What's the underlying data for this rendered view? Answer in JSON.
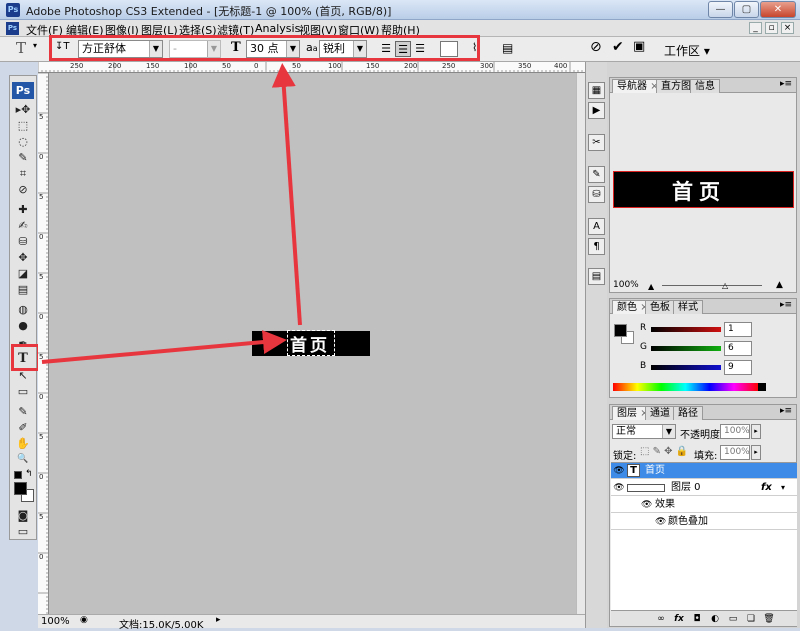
{
  "window": {
    "title": "Adobe Photoshop CS3 Extended - [无标题-1 @ 100% (首页, RGB/8)]",
    "app_icon": "Ps"
  },
  "menubar": {
    "items": [
      "文件(F)",
      "编辑(E)",
      "图像(I)",
      "图层(L)",
      "选择(S)",
      "滤镜(T)",
      "Analysis",
      "视图(V)",
      "窗口(W)",
      "帮助(H)"
    ]
  },
  "options": {
    "font_family": "方正舒体",
    "font_style": "-",
    "font_size": "30 点",
    "aa_glyph": "a",
    "aa_glyph_small": "a",
    "antialias": "锐利",
    "workspace": "工作区",
    "size_glyph": "T",
    "tool_glyph": "T",
    "orient_glyph": "↧T"
  },
  "toolbox": {
    "logo": "Ps",
    "tools": [
      "▸✥",
      "⬚",
      "◌",
      "✎",
      "⌗",
      "⊘",
      "✚",
      "✍",
      "⛁",
      "✥",
      "◪",
      "▤",
      "◍",
      "●",
      "✒",
      "T",
      "↖",
      "▭",
      "✎",
      "✐",
      "✋",
      "🔍"
    ]
  },
  "ruler": {
    "h_labels": [
      "250",
      "200",
      "150",
      "100",
      "50",
      "0",
      "50",
      "100",
      "150",
      "200",
      "250",
      "300",
      "350",
      "400"
    ],
    "v_labels": [
      "5",
      "0",
      "5",
      "0",
      "5",
      "0",
      "5",
      "0",
      "5",
      "0",
      "5",
      "0"
    ]
  },
  "canvas": {
    "text": "首页"
  },
  "status": {
    "zoom": "100%",
    "doc_info": "文档:15.0K/5.00K"
  },
  "navigator": {
    "tabs": [
      "导航器",
      "直方图",
      "信息"
    ],
    "preview_text": "首页",
    "zoom": "100%"
  },
  "color": {
    "tabs": [
      "颜色",
      "色板",
      "样式"
    ],
    "channels": [
      {
        "label": "R",
        "value": "1",
        "color": "#d01010"
      },
      {
        "label": "G",
        "value": "6",
        "color": "#10b010"
      },
      {
        "label": "B",
        "value": "9",
        "color": "#1010d0"
      }
    ]
  },
  "layers": {
    "tabs": [
      "图层",
      "通道",
      "路径"
    ],
    "blend_mode": "正常",
    "opacity_label": "不透明度:",
    "opacity": "100%",
    "lock_label": "锁定:",
    "fill_label": "填充:",
    "fill": "100%",
    "rows": [
      {
        "name": "首页",
        "thumb": "T",
        "fx": ""
      },
      {
        "name": "图层 0",
        "thumb": "",
        "fx": "fx"
      },
      {
        "name": "效果",
        "thumb": "",
        "fx": ""
      },
      {
        "name": "颜色叠加",
        "thumb": "",
        "fx": ""
      }
    ]
  },
  "colors": {
    "accent_red": "#e8363f",
    "selected_layer": "#3d8be6"
  }
}
